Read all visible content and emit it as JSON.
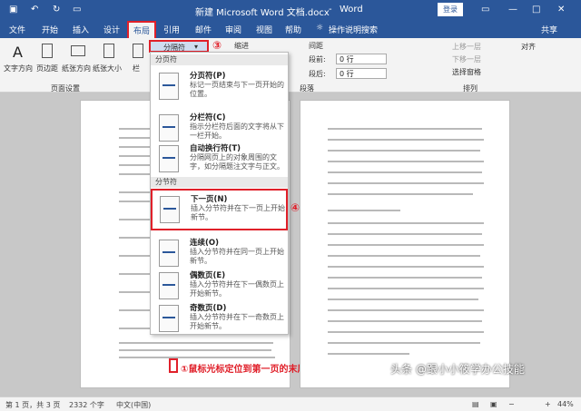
{
  "title": {
    "doc": "新建 Microsoft Word 文档.docx",
    "sep": "-",
    "app": "Word",
    "login": "登录"
  },
  "tabs": [
    "文件",
    "开始",
    "插入",
    "设计",
    "布局",
    "引用",
    "邮件",
    "审阅",
    "视图",
    "帮助"
  ],
  "tell_me": "操作说明搜索",
  "share": "共享",
  "ribbon": {
    "text_dir": "文字方向",
    "margins": "页边距",
    "orientation": "纸张方向",
    "size": "纸张大小",
    "columns": "栏",
    "breaks": "分隔符",
    "breaks_arrow": "▾",
    "indent": "缩进",
    "spacing": "间距",
    "before_label": "段前:",
    "after_label": "段后:",
    "before_val": "0 行",
    "after_val": "0 行",
    "paragraph": "段落",
    "page_setup": "页面设置",
    "bring_forward": "上移一层",
    "send_backward": "下移一层",
    "selection_pane": "选择窗格",
    "align": "对齐",
    "arrange": "排列"
  },
  "menu": {
    "sec1": "分页符",
    "sec2": "分节符",
    "items": [
      {
        "name": "分页符(P)",
        "desc": "标记一页结束与下一页开始的位置。"
      },
      {
        "name": "分栏符(C)",
        "desc": "指示分栏符后面的文字将从下一栏开始。"
      },
      {
        "name": "自动换行符(T)",
        "desc": "分隔网页上的对象周围的文字，如分隔题注文字与正文。"
      },
      {
        "name": "下一页(N)",
        "desc": "插入分节符并在下一页上开始新节。"
      },
      {
        "name": "连续(O)",
        "desc": "插入分节符并在同一页上开始新节。"
      },
      {
        "name": "偶数页(E)",
        "desc": "插入分节符并在下一偶数页上开始新节。"
      },
      {
        "name": "奇数页(D)",
        "desc": "插入分节符并在下一奇数页上开始新节。"
      }
    ]
  },
  "annotations": {
    "a1": "①鼠标光标定位到第一页的末尾",
    "a3": "③",
    "a4": "④"
  },
  "status": {
    "page": "第 1 页，共 3 页",
    "words": "2332 个字",
    "lang": "中文(中国)",
    "zoom": "44%"
  },
  "watermark": "头条 @跟小小筱学办公技能"
}
